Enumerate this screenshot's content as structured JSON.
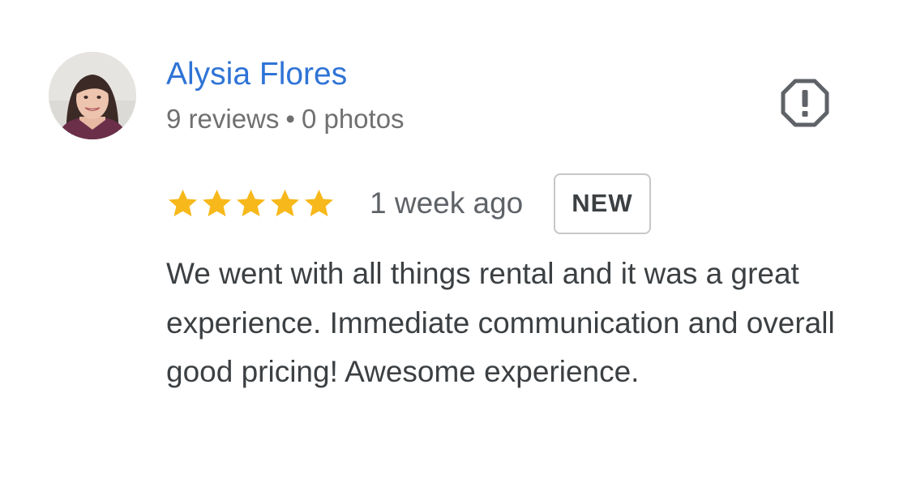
{
  "review": {
    "author": {
      "name": "Alysia Flores",
      "reviews_count": "9 reviews",
      "separator": "•",
      "photos_count": "0 photos",
      "avatar_icon": "user-avatar-photo"
    },
    "report_icon": "report-octagon-icon",
    "rating": {
      "stars": 5,
      "max_stars": 5,
      "star_color": "#f6b81a"
    },
    "time_ago": "1 week ago",
    "badge": "NEW",
    "text": "We went with all things rental and it was a great experience. Immediate communication and overall good pricing! Awesome experience."
  },
  "colors": {
    "author_link": "#2f74d6",
    "meta_text": "#707070",
    "body_text": "#3c4043",
    "badge_border": "#c7c7c7",
    "icon": "#5f6368"
  }
}
